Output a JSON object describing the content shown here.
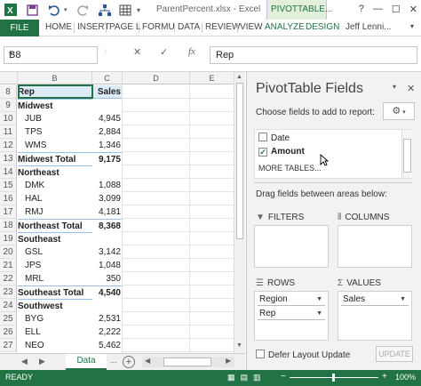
{
  "window": {
    "title": "ParentPercent.xlsx - Excel",
    "context_tab": "PIVOTTABLE...",
    "controls": [
      "?",
      "—",
      "☐",
      "✕"
    ]
  },
  "ribbon": {
    "file_label": "FILE",
    "tabs": [
      "HOME",
      "INSERT",
      "PAGE L",
      "FORMU",
      "DATA",
      "REVIEW",
      "VIEW",
      "ANALYZE",
      "DESIGN"
    ],
    "user": "Jeff Lenni..."
  },
  "formula_bar": {
    "name_box": "B8",
    "cancel": "✕",
    "enter": "✓",
    "fx": "fx",
    "value": "Rep"
  },
  "grid": {
    "columns": [
      "B",
      "C",
      "D",
      "E"
    ],
    "rows": [
      {
        "n": "8",
        "b": "Rep",
        "c": "Sales",
        "kind": "header"
      },
      {
        "n": "9",
        "b": "Midwest",
        "c": "",
        "kind": "group"
      },
      {
        "n": "10",
        "b": "JUB",
        "c": "4,945",
        "kind": "item"
      },
      {
        "n": "11",
        "b": "TPS",
        "c": "2,884",
        "kind": "item"
      },
      {
        "n": "12",
        "b": "WMS",
        "c": "1,346",
        "kind": "item"
      },
      {
        "n": "13",
        "b": "Midwest Total",
        "c": "9,175",
        "kind": "total"
      },
      {
        "n": "14",
        "b": "Northeast",
        "c": "",
        "kind": "group"
      },
      {
        "n": "15",
        "b": "DMK",
        "c": "1,088",
        "kind": "item"
      },
      {
        "n": "16",
        "b": "HAL",
        "c": "3,099",
        "kind": "item"
      },
      {
        "n": "17",
        "b": "RMJ",
        "c": "4,181",
        "kind": "item"
      },
      {
        "n": "18",
        "b": "Northeast Total",
        "c": "8,368",
        "kind": "total"
      },
      {
        "n": "19",
        "b": "Southeast",
        "c": "",
        "kind": "group"
      },
      {
        "n": "20",
        "b": "GSL",
        "c": "3,142",
        "kind": "item"
      },
      {
        "n": "21",
        "b": "JPS",
        "c": "1,048",
        "kind": "item"
      },
      {
        "n": "22",
        "b": "MRL",
        "c": "350",
        "kind": "item"
      },
      {
        "n": "23",
        "b": "Southeast Total",
        "c": "4,540",
        "kind": "total"
      },
      {
        "n": "24",
        "b": "Southwest",
        "c": "",
        "kind": "group"
      },
      {
        "n": "25",
        "b": "BYG",
        "c": "2,531",
        "kind": "item"
      },
      {
        "n": "26",
        "b": "ELL",
        "c": "2,222",
        "kind": "item"
      },
      {
        "n": "27",
        "b": "NEO",
        "c": "5,462",
        "kind": "item"
      }
    ]
  },
  "sheets": {
    "tabs": [
      "Data"
    ],
    "ellipsis": "...",
    "add_icon": "+"
  },
  "status": {
    "ready": "READY",
    "zoom": "100%"
  },
  "pivot_pane": {
    "title": "PivotTable Fields",
    "subtitle": "Choose fields to add to report:",
    "fields": [
      {
        "label": "Date",
        "checked": false
      },
      {
        "label": "Amount",
        "checked": true
      }
    ],
    "more_tables": "MORE TABLES...",
    "drag_hint": "Drag fields between areas below:",
    "areas": {
      "filters": "FILTERS",
      "columns": "COLUMNS",
      "rows": "ROWS",
      "values": "VALUES"
    },
    "rows_items": [
      "Region",
      "Rep"
    ],
    "values_items": [
      "Sales"
    ],
    "defer_label": "Defer Layout Update",
    "update_label": "UPDATE"
  },
  "colors": {
    "excel_green": "#217346",
    "pivot_header": "#ddebf7",
    "pivot_border": "#9bc2e6"
  }
}
